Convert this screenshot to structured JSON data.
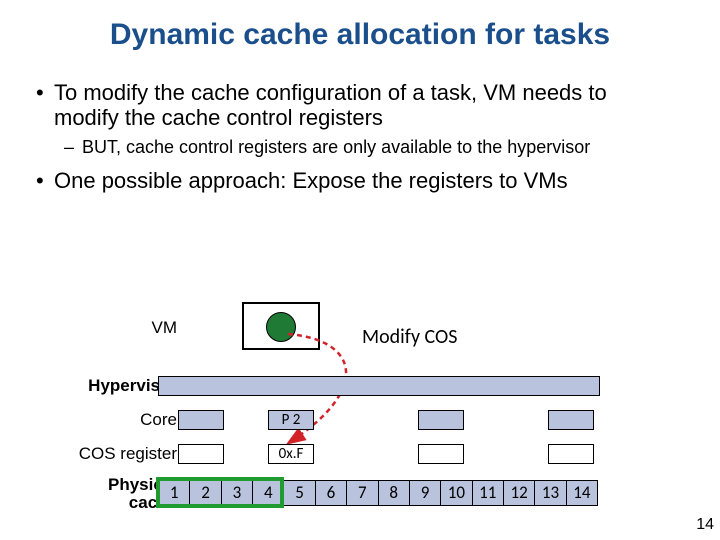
{
  "title": "Dynamic cache allocation for tasks",
  "bullets": {
    "b1": "To modify the cache configuration of a task, VM needs to modify the cache control registers",
    "b1_sub": "BUT, cache control registers are only available to the hypervisor",
    "b2": "One possible approach: Expose the registers to VMs"
  },
  "diagram": {
    "vm": "VM",
    "hypervisor": "Hypervisor",
    "core": "Core",
    "cos_register": "COS register",
    "physical_cache": "Physical\ncache",
    "modify": "Modify COS",
    "p2": "P 2",
    "oxF": "0x.F",
    "cache_cells": [
      "1",
      "2",
      "3",
      "4",
      "5",
      "6",
      "7",
      "8",
      "9",
      "10",
      "11",
      "12",
      "13",
      "14"
    ]
  },
  "slide_number": "14"
}
